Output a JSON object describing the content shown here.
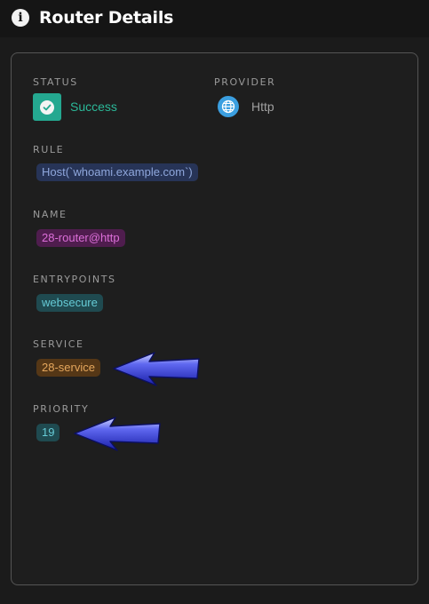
{
  "header": {
    "title": "Router Details",
    "icon": "info-icon"
  },
  "status": {
    "label": "STATUS",
    "value": "Success",
    "icon": "check-circle-icon",
    "color": "#24a890"
  },
  "provider": {
    "label": "PROVIDER",
    "value": "Http",
    "icon": "globe-icon",
    "color": "#3b9fe0"
  },
  "rule": {
    "label": "RULE",
    "value": "Host(`whoami.example.com`)"
  },
  "name": {
    "label": "NAME",
    "value": "28-router@http"
  },
  "entrypoints": {
    "label": "ENTRYPOINTS",
    "values": [
      "websecure"
    ]
  },
  "service": {
    "label": "SERVICE",
    "value": "28-service"
  },
  "priority": {
    "label": "PRIORITY",
    "value": "19"
  },
  "annotations": {
    "arrow_color": "#2a2fc8"
  }
}
